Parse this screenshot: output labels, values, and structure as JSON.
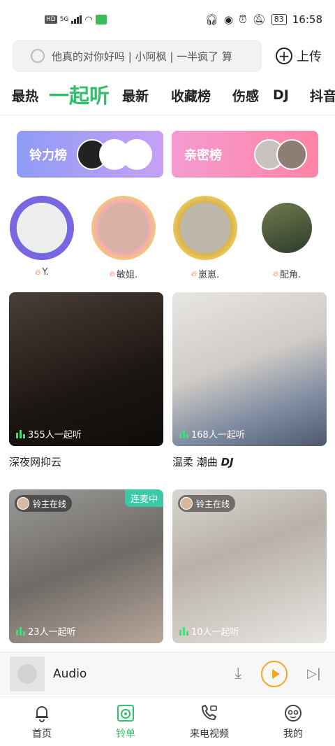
{
  "status_bar": {
    "hd": "HD",
    "net": "5G",
    "battery": "83",
    "time": "16:58"
  },
  "search": {
    "placeholder": "他真的对你好吗 | 小阿枫 | 一半疯了 算"
  },
  "upload_label": "上传",
  "tabs": [
    "最热",
    "一起听",
    "最新",
    "收藏榜",
    "伤感",
    "DJ",
    "抖音"
  ],
  "active_tab": "一起听",
  "ranks": [
    {
      "label": "铃力榜"
    },
    {
      "label": "亲密榜"
    }
  ],
  "hosts": [
    {
      "name": "Y."
    },
    {
      "name": "敏姐."
    },
    {
      "name": "崽崽."
    },
    {
      "name": "配角."
    }
  ],
  "rooms": [
    {
      "count": "355人一起听",
      "title": "深夜网抑云"
    },
    {
      "count": "168人一起听",
      "title": "温柔 潮曲",
      "title_tag": "DJ"
    },
    {
      "count": "23人一起听",
      "badge": "铃主在线",
      "mic_tag": "连麦中"
    },
    {
      "count": "10人一起听",
      "badge": "铃主在线"
    }
  ],
  "player": {
    "title": "Audio"
  },
  "nav": [
    {
      "label": "首页",
      "icon": "bell-icon"
    },
    {
      "label": "铃单",
      "icon": "disc-icon",
      "active": true
    },
    {
      "label": "来电视频",
      "icon": "phone-video-icon"
    },
    {
      "label": "我的",
      "icon": "profile-face-icon"
    }
  ],
  "colors": {
    "accent": "#2fbf6a",
    "play": "#f5a623"
  }
}
